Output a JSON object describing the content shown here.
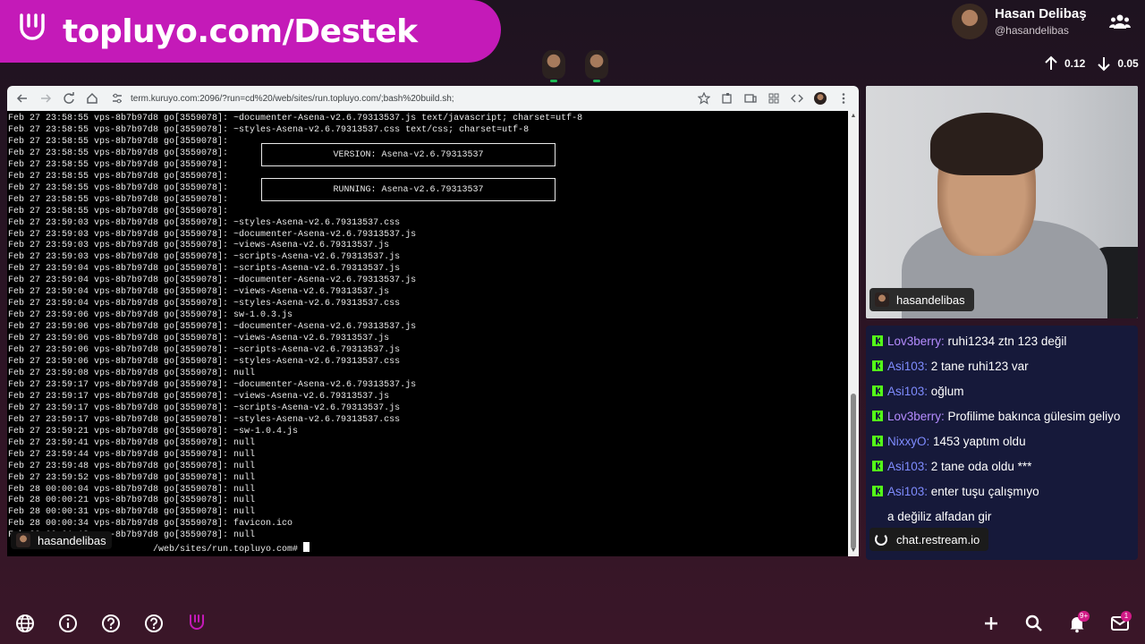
{
  "banner": {
    "text": "topluyo.com/Destek"
  },
  "profile": {
    "name": "Hasan Delibaş",
    "handle": "@hasandelibas"
  },
  "stats": {
    "up": "0.12",
    "down": "0.05"
  },
  "browser": {
    "url": "term.kuruyo.com:2096/?run=cd%20/web/sites/run.topluyo.com/;bash%20build.sh;"
  },
  "terminal": {
    "lines": [
      "Feb 27 23:58:55 vps-8b7b97d8 go[3559078]: ~documenter-Asena-v2.6.79313537.js text/javascript; charset=utf-8",
      "Feb 27 23:58:55 vps-8b7b97d8 go[3559078]: ~styles-Asena-v2.6.79313537.css text/css; charset=utf-8",
      "Feb 27 23:58:55 vps-8b7b97d8 go[3559078]:",
      "Feb 27 23:58:55 vps-8b7b97d8 go[3559078]:",
      "Feb 27 23:58:55 vps-8b7b97d8 go[3559078]:",
      "Feb 27 23:58:55 vps-8b7b97d8 go[3559078]:",
      "Feb 27 23:58:55 vps-8b7b97d8 go[3559078]:",
      "Feb 27 23:58:55 vps-8b7b97d8 go[3559078]:",
      "Feb 27 23:58:55 vps-8b7b97d8 go[3559078]:",
      "Feb 27 23:59:03 vps-8b7b97d8 go[3559078]: ~styles-Asena-v2.6.79313537.css",
      "Feb 27 23:59:03 vps-8b7b97d8 go[3559078]: ~documenter-Asena-v2.6.79313537.js",
      "Feb 27 23:59:03 vps-8b7b97d8 go[3559078]: ~views-Asena-v2.6.79313537.js",
      "Feb 27 23:59:03 vps-8b7b97d8 go[3559078]: ~scripts-Asena-v2.6.79313537.js",
      "Feb 27 23:59:04 vps-8b7b97d8 go[3559078]: ~scripts-Asena-v2.6.79313537.js",
      "Feb 27 23:59:04 vps-8b7b97d8 go[3559078]: ~documenter-Asena-v2.6.79313537.js",
      "Feb 27 23:59:04 vps-8b7b97d8 go[3559078]: ~views-Asena-v2.6.79313537.js",
      "Feb 27 23:59:04 vps-8b7b97d8 go[3559078]: ~styles-Asena-v2.6.79313537.css",
      "Feb 27 23:59:06 vps-8b7b97d8 go[3559078]: sw-1.0.3.js",
      "Feb 27 23:59:06 vps-8b7b97d8 go[3559078]: ~documenter-Asena-v2.6.79313537.js",
      "Feb 27 23:59:06 vps-8b7b97d8 go[3559078]: ~views-Asena-v2.6.79313537.js",
      "Feb 27 23:59:06 vps-8b7b97d8 go[3559078]: ~scripts-Asena-v2.6.79313537.js",
      "Feb 27 23:59:06 vps-8b7b97d8 go[3559078]: ~styles-Asena-v2.6.79313537.css",
      "Feb 27 23:59:08 vps-8b7b97d8 go[3559078]: null",
      "Feb 27 23:59:17 vps-8b7b97d8 go[3559078]: ~documenter-Asena-v2.6.79313537.js",
      "Feb 27 23:59:17 vps-8b7b97d8 go[3559078]: ~views-Asena-v2.6.79313537.js",
      "Feb 27 23:59:17 vps-8b7b97d8 go[3559078]: ~scripts-Asena-v2.6.79313537.js",
      "Feb 27 23:59:17 vps-8b7b97d8 go[3559078]: ~styles-Asena-v2.6.79313537.css",
      "Feb 27 23:59:21 vps-8b7b97d8 go[3559078]: ~sw-1.0.4.js",
      "Feb 27 23:59:41 vps-8b7b97d8 go[3559078]: null",
      "Feb 27 23:59:44 vps-8b7b97d8 go[3559078]: null",
      "Feb 27 23:59:48 vps-8b7b97d8 go[3559078]: null",
      "Feb 27 23:59:52 vps-8b7b97d8 go[3559078]: null",
      "Feb 28 00:00:04 vps-8b7b97d8 go[3559078]: null",
      "Feb 28 00:00:21 vps-8b7b97d8 go[3559078]: null",
      "Feb 28 00:00:31 vps-8b7b97d8 go[3559078]: null",
      "Feb 28 00:00:34 vps-8b7b97d8 go[3559078]: favicon.ico",
      "Feb 28 00:01:13 vps-8b7b97d8 go[3559078]: null"
    ],
    "version_box": "VERSION: Asena-v2.6.79313537",
    "running_box": "RUNNING: Asena-v2.6.79313537",
    "prompt": "/web/sites/run.topluyo.com# "
  },
  "screen_tag": {
    "name": "hasandelibas"
  },
  "cam_tag": {
    "name": "hasandelibas"
  },
  "chat": {
    "messages": [
      {
        "user": "Lov3berry:",
        "text": " ruhi1234 ztn 123 değil",
        "color": "pink"
      },
      {
        "user": "Asi103:",
        "text": " 2 tane ruhi123 var",
        "color": "blue"
      },
      {
        "user": "Asi103:",
        "text": " oğlum",
        "color": "blue"
      },
      {
        "user": "Lov3berry:",
        "text": " Profilime bakınca gülesim geliyo",
        "color": "pink"
      },
      {
        "user": "NixxyO:",
        "text": " 1453 yaptım oldu",
        "color": "blue"
      },
      {
        "user": "Asi103:",
        "text": " 2 tane oda oldu ***",
        "color": "blue"
      },
      {
        "user": "Asi103:",
        "text": " enter tuşu çalışmıyo",
        "color": "blue"
      },
      {
        "user": "",
        "text": "a değiliz alfadan gir",
        "color": "blue"
      }
    ],
    "source": "chat.restream.io"
  },
  "bottom": {
    "notification_badge": "9+",
    "mail_badge": "1"
  }
}
